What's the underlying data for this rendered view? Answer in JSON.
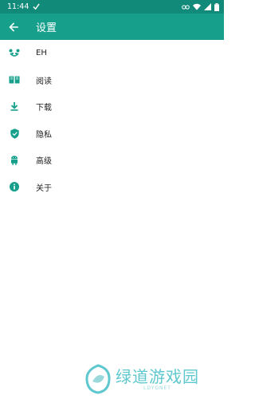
{
  "status_bar": {
    "time": "11:44",
    "icons": [
      "signal-check-icon",
      "link-icon",
      "wifi-icon",
      "cell-signal-icon",
      "battery-icon"
    ]
  },
  "app_bar": {
    "title": "设置",
    "back_icon": "arrow-back-icon"
  },
  "settings_items": [
    {
      "label": "EH",
      "icon": "panda-icon"
    },
    {
      "label": "阅读",
      "icon": "book-icon"
    },
    {
      "label": "下载",
      "icon": "download-icon"
    },
    {
      "label": "隐私",
      "icon": "shield-icon"
    },
    {
      "label": "高级",
      "icon": "android-icon"
    },
    {
      "label": "关于",
      "icon": "info-icon"
    }
  ],
  "watermark": {
    "main_text": "绿道游戏园",
    "sub_text": "LDYGNET"
  },
  "colors": {
    "status_bar": "#128a7a",
    "app_bar": "#16a08c",
    "icon_tint": "#16a08c",
    "watermark": "#5ec8ce"
  }
}
